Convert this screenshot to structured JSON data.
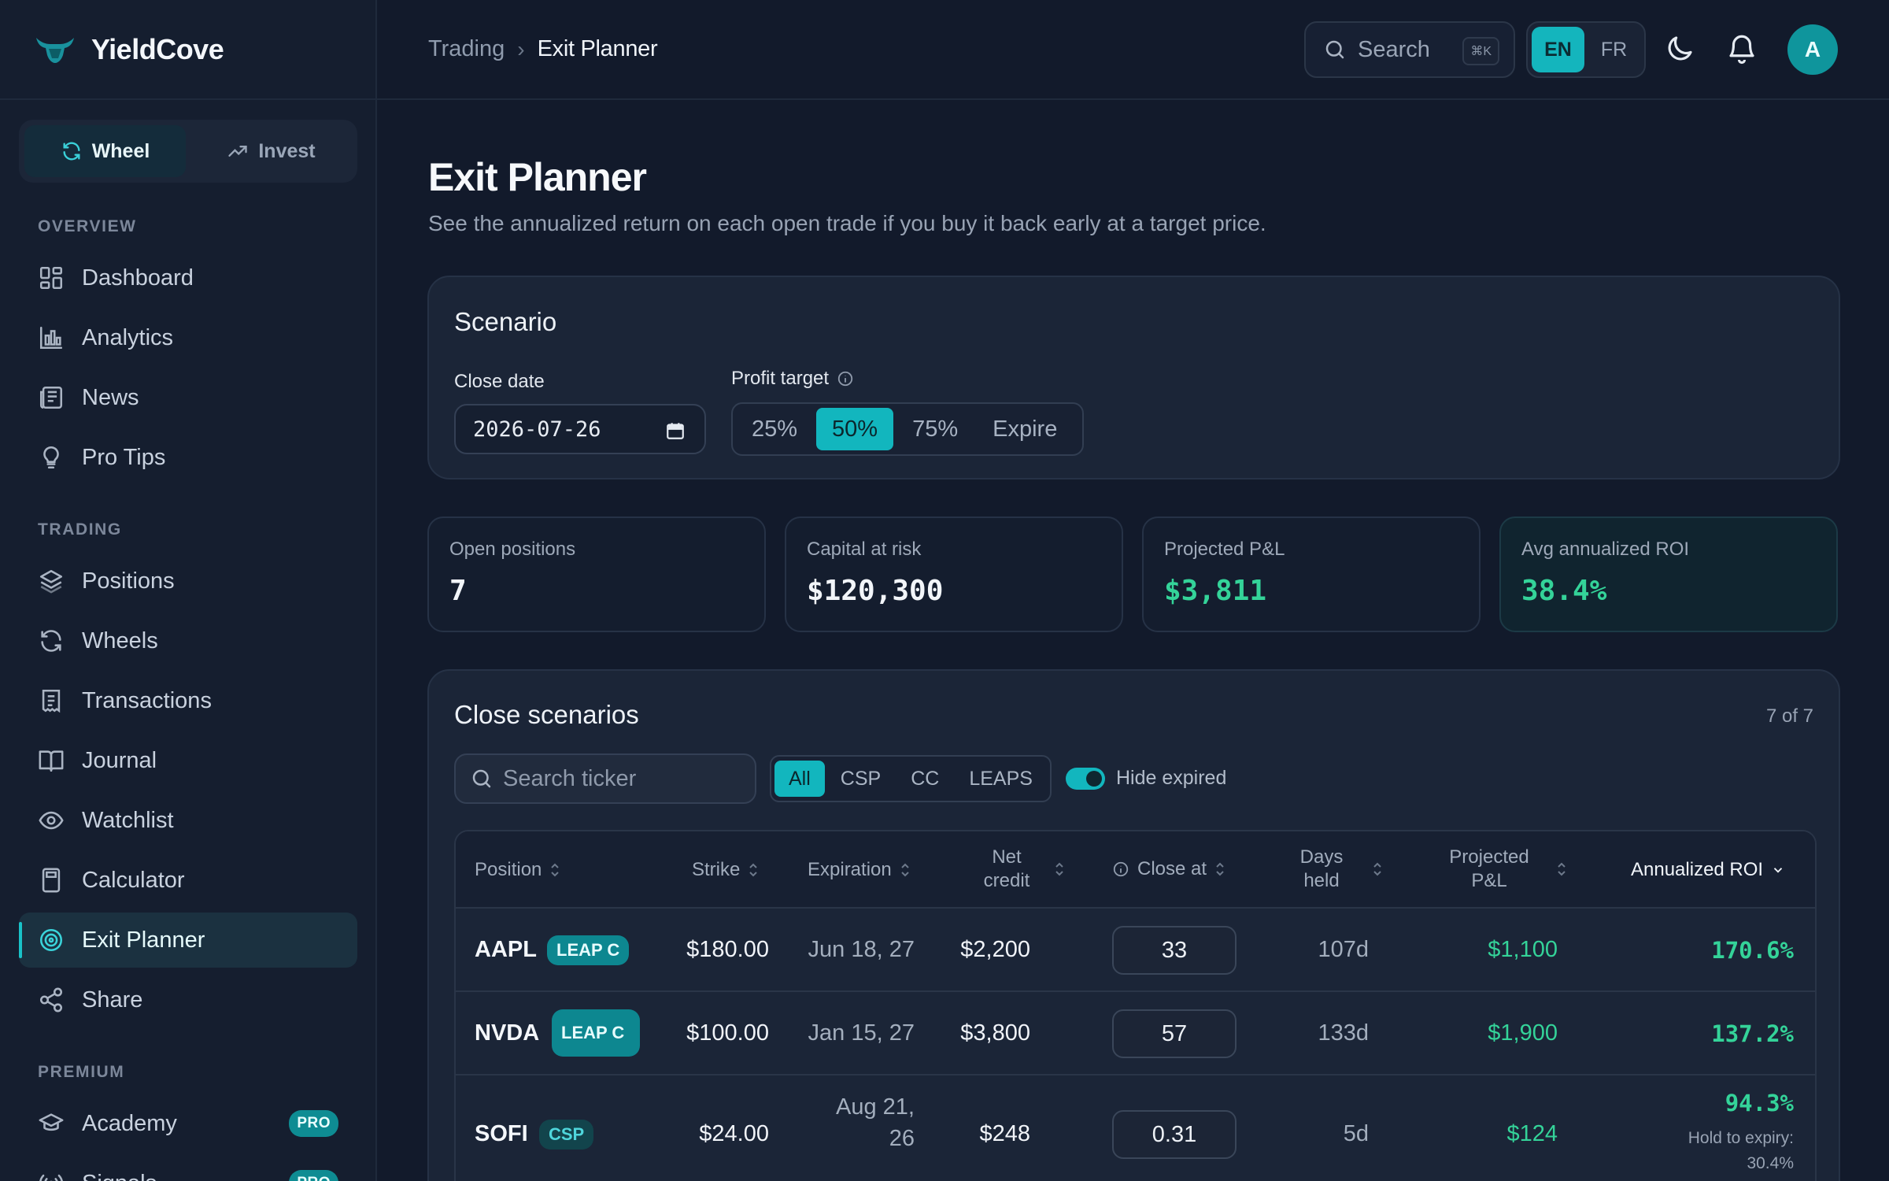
{
  "brand": {
    "name": "YieldCove"
  },
  "mode_switch": [
    {
      "label": "Wheel",
      "icon": "refresh-icon",
      "active": true
    },
    {
      "label": "Invest",
      "icon": "trending-up-icon",
      "active": false
    }
  ],
  "sidebar": {
    "sections": [
      {
        "title": "OVERVIEW",
        "items": [
          {
            "label": "Dashboard",
            "icon": "grid-icon"
          },
          {
            "label": "Analytics",
            "icon": "bar-chart-icon"
          },
          {
            "label": "News",
            "icon": "newspaper-icon"
          },
          {
            "label": "Pro Tips",
            "icon": "lightbulb-icon"
          }
        ]
      },
      {
        "title": "TRADING",
        "items": [
          {
            "label": "Positions",
            "icon": "layers-icon"
          },
          {
            "label": "Wheels",
            "icon": "refresh-icon"
          },
          {
            "label": "Transactions",
            "icon": "receipt-icon"
          },
          {
            "label": "Journal",
            "icon": "book-icon"
          },
          {
            "label": "Watchlist",
            "icon": "eye-icon"
          },
          {
            "label": "Calculator",
            "icon": "calculator-icon"
          },
          {
            "label": "Exit Planner",
            "icon": "target-icon",
            "active": true
          },
          {
            "label": "Share",
            "icon": "share-icon"
          }
        ]
      },
      {
        "title": "PREMIUM",
        "items": [
          {
            "label": "Academy",
            "icon": "graduation-cap-icon",
            "badge": "PRO"
          },
          {
            "label": "Signals",
            "icon": "signal-icon",
            "badge": "PRO"
          }
        ]
      }
    ]
  },
  "header": {
    "breadcrumb": [
      "Trading",
      "Exit Planner"
    ],
    "search_label": "Search",
    "search_shortcut": "⌘K",
    "languages": [
      {
        "label": "EN",
        "active": true
      },
      {
        "label": "FR",
        "active": false
      }
    ],
    "avatar_initial": "A"
  },
  "page": {
    "title": "Exit Planner",
    "subtitle": "See the annualized return on each open trade if you buy it back early at a target price."
  },
  "scenario": {
    "title": "Scenario",
    "close_date_label": "Close date",
    "close_date_value": "2026-07-26",
    "profit_target_label": "Profit target",
    "profit_targets": [
      "25%",
      "50%",
      "75%",
      "Expire"
    ],
    "profit_target_selected": "50%"
  },
  "stats": [
    {
      "label": "Open positions",
      "value": "7",
      "tone": "plain"
    },
    {
      "label": "Capital at risk",
      "value": "$120,300",
      "tone": "plain"
    },
    {
      "label": "Projected P&L",
      "value": "$3,811",
      "tone": "green"
    },
    {
      "label": "Avg annualized ROI",
      "value": "38.4%",
      "tone": "green"
    }
  ],
  "close_scenarios": {
    "title": "Close scenarios",
    "count": "7 of 7",
    "search_placeholder": "Search ticker",
    "filters": [
      "All",
      "CSP",
      "CC",
      "LEAPS"
    ],
    "filter_selected": "All",
    "hide_expired_label": "Hide expired",
    "hide_expired": true,
    "columns": {
      "position": "Position",
      "strike": "Strike",
      "expiration": "Expiration",
      "net_credit": "Net credit",
      "close_at": "Close at",
      "days_held": "Days held",
      "projected_pl": "Projected P&L",
      "annualized_roi": "Annualized ROI"
    },
    "rows": [
      {
        "ticker": "AAPL",
        "type": "LEAP C",
        "strike": "$180.00",
        "expiration": "Jun 18, 27",
        "net_credit": "$2,200",
        "close_at": "33",
        "days_held": "107d",
        "projected_pl": "$1,100",
        "roi": "170.6%"
      },
      {
        "ticker": "NVDA",
        "type": "LEAP C",
        "strike": "$100.00",
        "expiration": "Jan 15, 27",
        "net_credit": "$3,800",
        "close_at": "57",
        "days_held": "133d",
        "projected_pl": "$1,900",
        "roi": "137.2%"
      },
      {
        "ticker": "SOFI",
        "type": "CSP",
        "strike": "$24.00",
        "expiration": "Aug 21, 26",
        "net_credit": "$248",
        "close_at": "0.31",
        "days_held": "5d",
        "projected_pl": "$124",
        "roi": "94.3%",
        "hold_to_expiry": "Hold to expiry: 30.4%"
      }
    ]
  },
  "colors": {
    "accent": "#12b6be",
    "positive": "#34d399",
    "background": "#121a2b",
    "sidebar": "#151e2f",
    "card": "#1b2537"
  }
}
